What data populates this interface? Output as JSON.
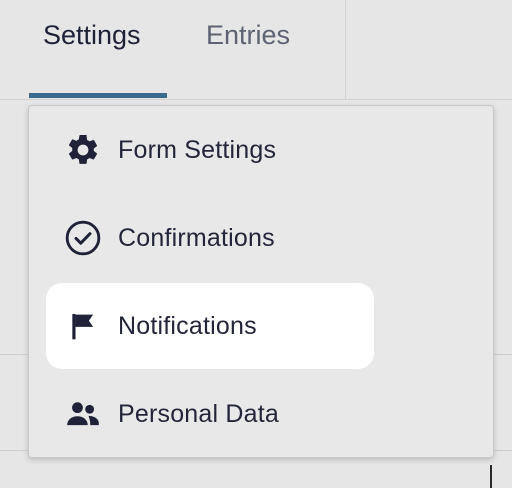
{
  "tabs": {
    "settings_label": "Settings",
    "entries_label": "Entries"
  },
  "menu": {
    "items": [
      {
        "label": "Form Settings",
        "icon": "gear-icon",
        "active": false
      },
      {
        "label": "Confirmations",
        "icon": "check-circle-icon",
        "active": false
      },
      {
        "label": "Notifications",
        "icon": "flag-icon",
        "active": true
      },
      {
        "label": "Personal Data",
        "icon": "users-icon",
        "active": false
      }
    ]
  },
  "colors": {
    "accent": "#3a6b8f",
    "text": "#23263a",
    "active_bg": "#ffffff",
    "background": "#e6e6e6"
  }
}
